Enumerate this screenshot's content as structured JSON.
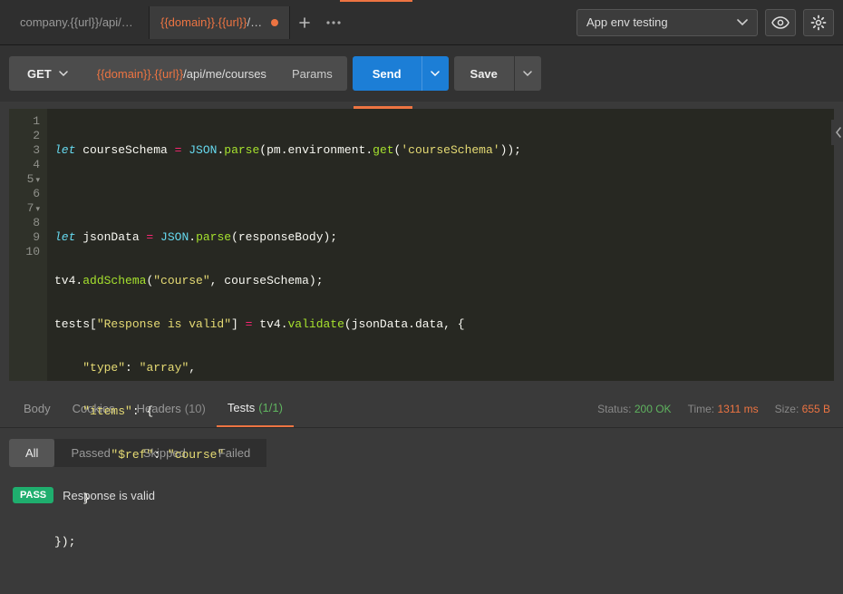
{
  "tabs": {
    "items": [
      {
        "label_var": "",
        "label_plain": "company.{{url}}/api/auth/lo"
      },
      {
        "label_var": "{{domain}}.{{url}}",
        "label_plain": "/api"
      }
    ]
  },
  "env": {
    "selected": "App env testing"
  },
  "request": {
    "method": "GET",
    "url_var": "{{domain}}.{{url}}",
    "url_rest": "/api/me/courses",
    "params_label": "Params",
    "send_label": "Send",
    "save_label": "Save"
  },
  "editor": {
    "line_numbers": [
      "1",
      "2",
      "3",
      "4",
      "5",
      "6",
      "7",
      "8",
      "9",
      "10"
    ],
    "lines": {
      "l1_let": "let",
      "l1_a": " courseSchema ",
      "l1_eq": "=",
      "l1_b": " JSON",
      "l1_c": ".",
      "l1_parse": "parse",
      "l1_d": "(pm",
      "l1_e": ".",
      "l1_env": "environment",
      "l1_f": ".",
      "l1_get": "get",
      "l1_g": "(",
      "l1_str": "'courseSchema'",
      "l1_h": "));",
      "l3_let": "let",
      "l3_a": " jsonData ",
      "l3_eq": "=",
      "l3_b": " JSON",
      "l3_c": ".",
      "l3_parse": "parse",
      "l3_d": "(responseBody);",
      "l4_a": "tv4",
      "l4_b": ".",
      "l4_add": "addSchema",
      "l4_c": "(",
      "l4_s1": "\"course\"",
      "l4_d": ", courseSchema);",
      "l5_a": "tests[",
      "l5_s": "\"Response is valid\"",
      "l5_b": "] ",
      "l5_eq": "=",
      "l5_c": " tv4",
      "l5_d": ".",
      "l5_val": "validate",
      "l5_e": "(jsonData",
      "l5_f": ".",
      "l5_data": "data",
      "l5_g": ", {",
      "l6_k": "\"type\"",
      "l6_c": ": ",
      "l6_v": "\"array\"",
      "l6_e": ",",
      "l7_k": "\"items\"",
      "l7_c": ": {",
      "l8_k": "\"$ref\"",
      "l8_c": ": ",
      "l8_v": "\"course\"",
      "l9": "    }",
      "l10": "});"
    }
  },
  "response": {
    "tabs": {
      "body": "Body",
      "cookies": "Cookies",
      "headers": "Headers",
      "headers_count": "(10)",
      "tests": "Tests",
      "tests_count": "(1/1)"
    },
    "meta": {
      "status_label": "Status:",
      "status_value": "200 OK",
      "time_label": "Time:",
      "time_value": "1311 ms",
      "size_label": "Size:",
      "size_value": "655 B"
    },
    "filters": {
      "all": "All",
      "passed": "Passed",
      "skipped": "Skipped",
      "failed": "Failed"
    },
    "tests_list": [
      {
        "badge": "PASS",
        "name": "Response is valid"
      }
    ]
  }
}
